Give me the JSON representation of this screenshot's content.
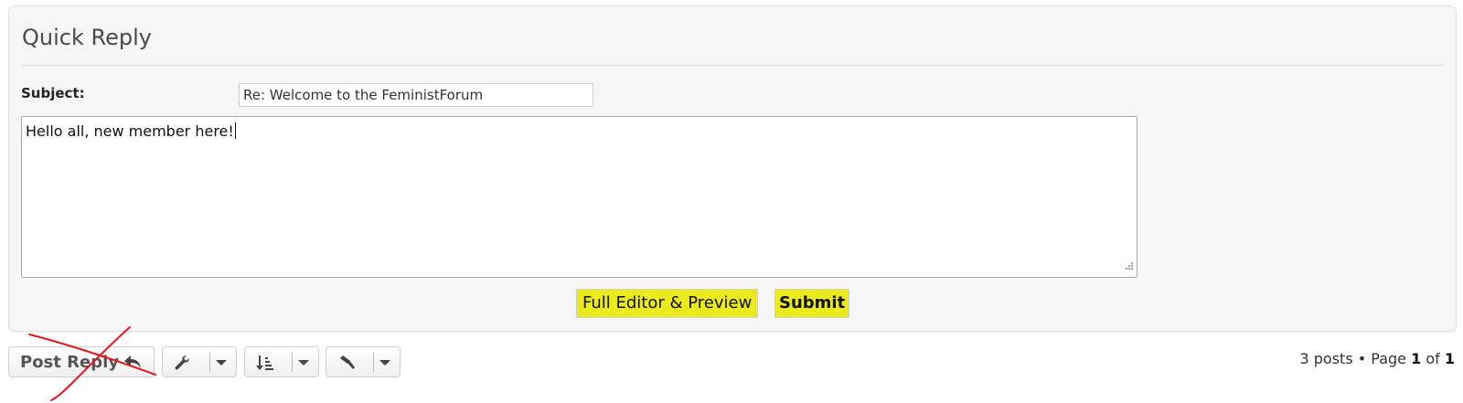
{
  "quick_reply": {
    "title": "Quick Reply",
    "subject_label": "Subject:",
    "subject_value": "Re: Welcome to the FeministForum",
    "message_value": "Hello all, new member here!",
    "full_editor_label": "Full Editor & Preview",
    "submit_label": "Submit"
  },
  "toolbar": {
    "post_reply_label": "Post Reply",
    "icons": [
      "reply-icon",
      "wrench-icon",
      "sort-icon",
      "moderator-hammer-icon",
      "chevron-down-icon"
    ]
  },
  "pagination": {
    "posts_text": "3 posts",
    "separator": "•",
    "page_word": "Page",
    "current_page": "1",
    "of_word": "of",
    "total_pages": "1"
  },
  "colors": {
    "highlight": "#eaea1c",
    "annotation_red": "#e8141e"
  }
}
